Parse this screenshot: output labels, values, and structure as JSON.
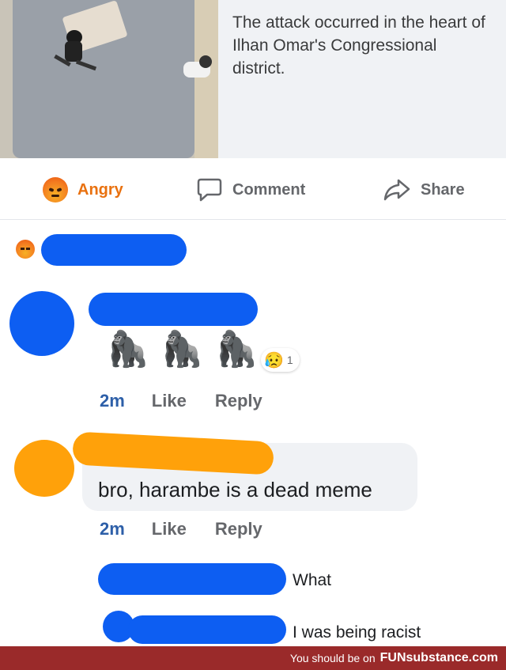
{
  "post": {
    "preview_text": "The attack occurred in the heart of Ilhan Omar's Congressional district."
  },
  "actions": {
    "reaction_label": "Angry",
    "comment_label": "Comment",
    "share_label": "Share"
  },
  "comments": [
    {
      "reactions": [
        "gorilla",
        "gorilla",
        "gorilla"
      ],
      "reaction_count": "1",
      "time": "2m",
      "like_label": "Like",
      "reply_label": "Reply"
    },
    {
      "text": "bro, harambe is a dead meme",
      "time": "2m",
      "like_label": "Like",
      "reply_label": "Reply"
    }
  ],
  "replies": [
    {
      "text": "What"
    },
    {
      "text": "I was being racist"
    }
  ],
  "footer": {
    "prefix": "You should be on",
    "brand": "FUNsubstance.com"
  },
  "colors": {
    "redaction_blue": "#0d5ef2",
    "redaction_orange": "#ffa10a",
    "footer_bg": "#9a2a2a",
    "angry_orange": "#e9710f"
  }
}
